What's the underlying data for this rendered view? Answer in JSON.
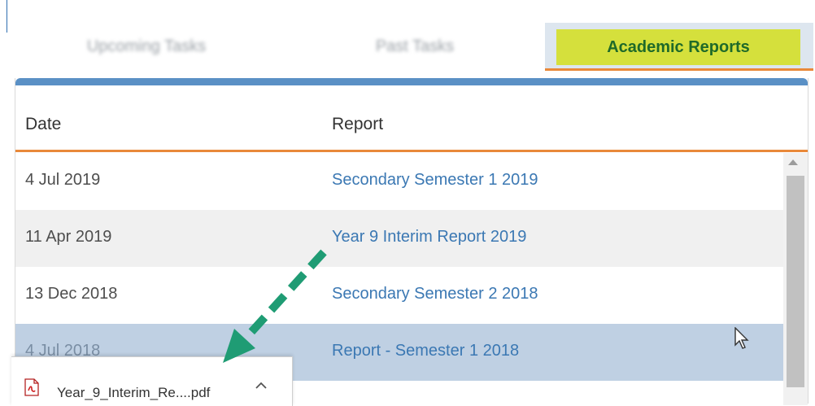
{
  "tabs": [
    {
      "label": "Upcoming Tasks",
      "state": "blurred"
    },
    {
      "label": "Past Tasks",
      "state": "blurred"
    },
    {
      "label": "Academic Reports",
      "state": "active"
    }
  ],
  "table": {
    "headers": {
      "date": "Date",
      "report": "Report"
    },
    "rows": [
      {
        "date": "4 Jul 2019",
        "report": "Secondary Semester 1 2019"
      },
      {
        "date": "11 Apr 2019",
        "report": "Year 9 Interim Report 2019"
      },
      {
        "date": "13 Dec 2018",
        "report": "Secondary Semester 2 2018"
      },
      {
        "date": "4 Jul 2018",
        "report": "Report - Semester 1 2018"
      }
    ]
  },
  "download": {
    "filename": "Year_9_Interim_Re....pdf",
    "icon": "pdf-file-icon",
    "chevron": "chevron-up-icon"
  },
  "colors": {
    "active_tab_bg": "#d5e03c",
    "active_tab_text": "#1f6a29",
    "accent_orange": "#e9893a",
    "panel_bar_blue": "#5a90c5",
    "link_blue": "#3b78b3",
    "selected_row": "#bfd0e3",
    "arrow_green": "#1f9c74"
  }
}
